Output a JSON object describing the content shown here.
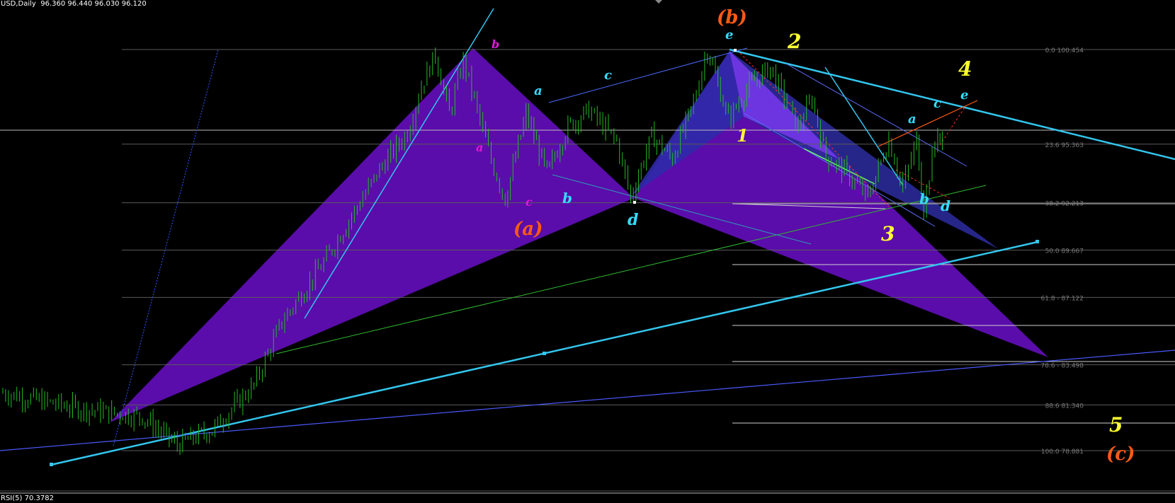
{
  "header": {
    "symbol": "USD,Daily",
    "ohlc": "96.360 96.440 96.030 96.120"
  },
  "indicator": {
    "label": "RSI(5) 70.3782"
  },
  "colors": {
    "background": "#000000",
    "candle": "#22bb22",
    "pattern_purple": "#6a0fc8",
    "pattern_blue": "#2f2aa8",
    "trend_cyan": "#33c6ee",
    "fib_line": "#5a5a5a",
    "wave_orange": "#ff5a14",
    "wave_yellow": "#ffff33",
    "wave_cyan": "#33ddff",
    "wave_magenta": "#e01ad8"
  },
  "chart_data": {
    "type": "candlestick",
    "title": "USD,Daily",
    "ohlc_last": {
      "open": 96.36,
      "high": 96.44,
      "low": 96.03,
      "close": 96.12
    },
    "fibonacci_levels": [
      {
        "label": "0.0 100.454",
        "ratio": 0.0,
        "price": 100.454
      },
      {
        "label": "23.6 95.363",
        "ratio": 23.6,
        "price": 95.363
      },
      {
        "label": "38.2 92.213",
        "ratio": 38.2,
        "price": 92.213
      },
      {
        "label": "50.0 89.667",
        "ratio": 50.0,
        "price": 89.667
      },
      {
        "label": "61.8 - 87.122",
        "ratio": 61.8,
        "price": 87.122
      },
      {
        "label": "78.6 - 83.498",
        "ratio": 78.6,
        "price": 83.498
      },
      {
        "label": "88.6 81.340",
        "ratio": 88.6,
        "price": 81.34
      },
      {
        "label": "100.0 78.881",
        "ratio": 100.0,
        "price": 78.881
      }
    ],
    "price_path": [
      [
        0,
        82.0
      ],
      [
        10,
        81.2
      ],
      [
        20,
        80.7
      ],
      [
        25,
        79.2
      ],
      [
        30,
        80.0
      ],
      [
        36,
        82.4
      ],
      [
        40,
        85.8
      ],
      [
        46,
        89.0
      ],
      [
        50,
        91.5
      ],
      [
        54,
        94.0
      ],
      [
        58,
        96.0
      ],
      [
        60,
        98.5
      ],
      [
        62,
        100.2
      ],
      [
        64,
        97.0
      ],
      [
        66,
        99.9
      ],
      [
        70,
        94.5
      ],
      [
        72,
        92.4
      ],
      [
        75,
        97.0
      ],
      [
        78,
        93.8
      ],
      [
        81,
        96.3
      ],
      [
        84,
        97.2
      ],
      [
        88,
        95.5
      ],
      [
        90,
        92.5
      ],
      [
        93,
        95.8
      ],
      [
        96,
        94.6
      ],
      [
        99,
        97.6
      ],
      [
        101,
        100.5
      ],
      [
        104,
        96.7
      ],
      [
        107,
        98.5
      ],
      [
        110,
        99.5
      ],
      [
        114,
        96.3
      ],
      [
        116,
        97.8
      ],
      [
        118,
        94.7
      ],
      [
        121,
        93.8
      ],
      [
        124,
        92.5
      ],
      [
        127,
        95.6
      ],
      [
        129,
        93.0
      ],
      [
        131,
        95.6
      ],
      [
        132,
        92.0
      ],
      [
        134,
        96.2
      ],
      [
        135,
        94.5
      ]
    ],
    "wave_labels": [
      {
        "text": "(a)",
        "color": "orange"
      },
      {
        "text": "(b)",
        "color": "orange"
      },
      {
        "text": "(c)",
        "color": "orange"
      },
      {
        "text": "1",
        "color": "yellow"
      },
      {
        "text": "2",
        "color": "yellow"
      },
      {
        "text": "3",
        "color": "yellow"
      },
      {
        "text": "4",
        "color": "yellow"
      },
      {
        "text": "5",
        "color": "yellow"
      },
      {
        "text": "a",
        "color": "cyan"
      },
      {
        "text": "b",
        "color": "cyan"
      },
      {
        "text": "c",
        "color": "cyan"
      },
      {
        "text": "d",
        "color": "cyan"
      },
      {
        "text": "e",
        "color": "cyan"
      },
      {
        "text": "a",
        "color": "magenta"
      },
      {
        "text": "b",
        "color": "magenta"
      },
      {
        "text": "c",
        "color": "magenta"
      }
    ],
    "grid": false
  }
}
